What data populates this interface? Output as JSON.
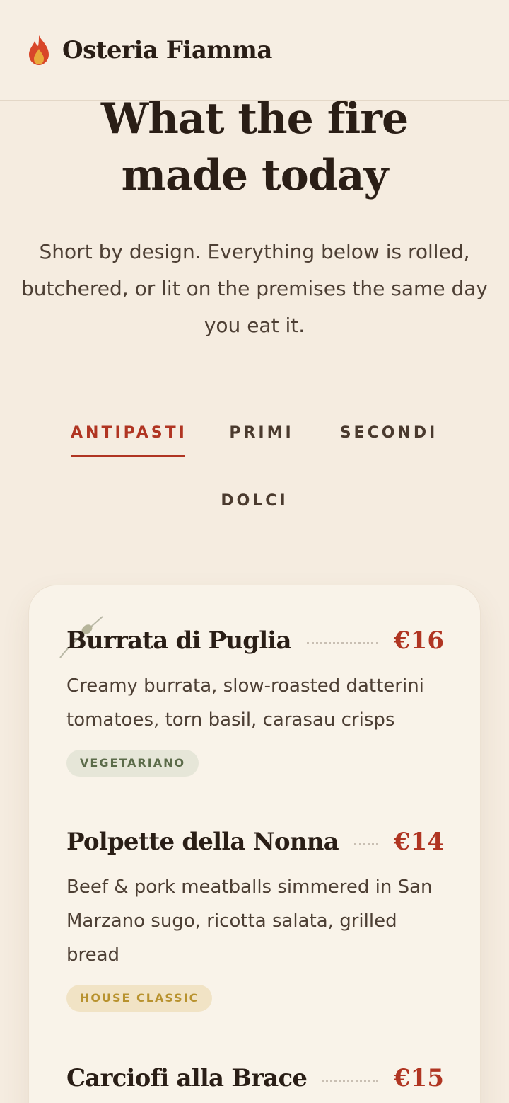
{
  "brand": {
    "name": "Osteria Fiamma",
    "icon": "flame-icon",
    "flame_outer": "#d8472a",
    "flame_inner": "#e9a93a"
  },
  "hero": {
    "title_line1": "What the fire",
    "title_line2": "made today",
    "subtitle": "Short by design. Everything below is rolled, butchered, or lit on the premises the same day you eat it."
  },
  "tabs": [
    {
      "label": "ANTIPASTI",
      "active": true
    },
    {
      "label": "PRIMI",
      "active": false
    },
    {
      "label": "SECONDI",
      "active": false
    },
    {
      "label": "DOLCI",
      "active": false
    }
  ],
  "menu": {
    "items": [
      {
        "name": "Burrata di Puglia",
        "price": "€16",
        "description": "Creamy burrata, slow-roasted datterini tomatoes, torn basil, carasau crisps",
        "badge": "VEGETARIANO"
      },
      {
        "name": "Polpette della Nonna",
        "price": "€14",
        "description": "Beef & pork meatballs simmered in San Marzano sugo, ricotta salata, grilled bread",
        "badge": "HOUSE CLASSIC"
      },
      {
        "name": "Carciofi alla Brace",
        "price": "€15"
      }
    ]
  },
  "colors": {
    "background": "#f5ece0",
    "accent": "#b03522",
    "card": "#f9f3e9",
    "text": "#2a1e16"
  }
}
